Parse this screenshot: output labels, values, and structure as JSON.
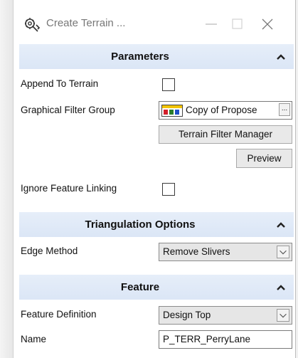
{
  "window": {
    "title": "Create Terrain ..."
  },
  "title_icon": "gear-wrench-icon",
  "parameters": {
    "header": "Parameters",
    "append_to_terrain_label": "Append To Terrain",
    "append_to_terrain_checked": false,
    "graphical_filter_group_label": "Graphical Filter Group",
    "graphical_filter_group_value": "Copy of Propose",
    "ellipsis_label": "...",
    "terrain_filter_manager_label": "Terrain Filter Manager",
    "preview_label": "Preview",
    "ignore_feature_linking_label": "Ignore Feature Linking",
    "ignore_feature_linking_checked": false
  },
  "triangulation": {
    "header": "Triangulation Options",
    "edge_method_label": "Edge Method",
    "edge_method_value": "Remove Slivers"
  },
  "feature": {
    "header": "Feature",
    "feature_definition_label": "Feature Definition",
    "feature_definition_value": "Design Top",
    "name_label": "Name",
    "name_value": "P_TERR_PerryLane"
  },
  "colors": {
    "header_bg": "#dbe6f6",
    "panel_bg": "#eaf0f8"
  }
}
